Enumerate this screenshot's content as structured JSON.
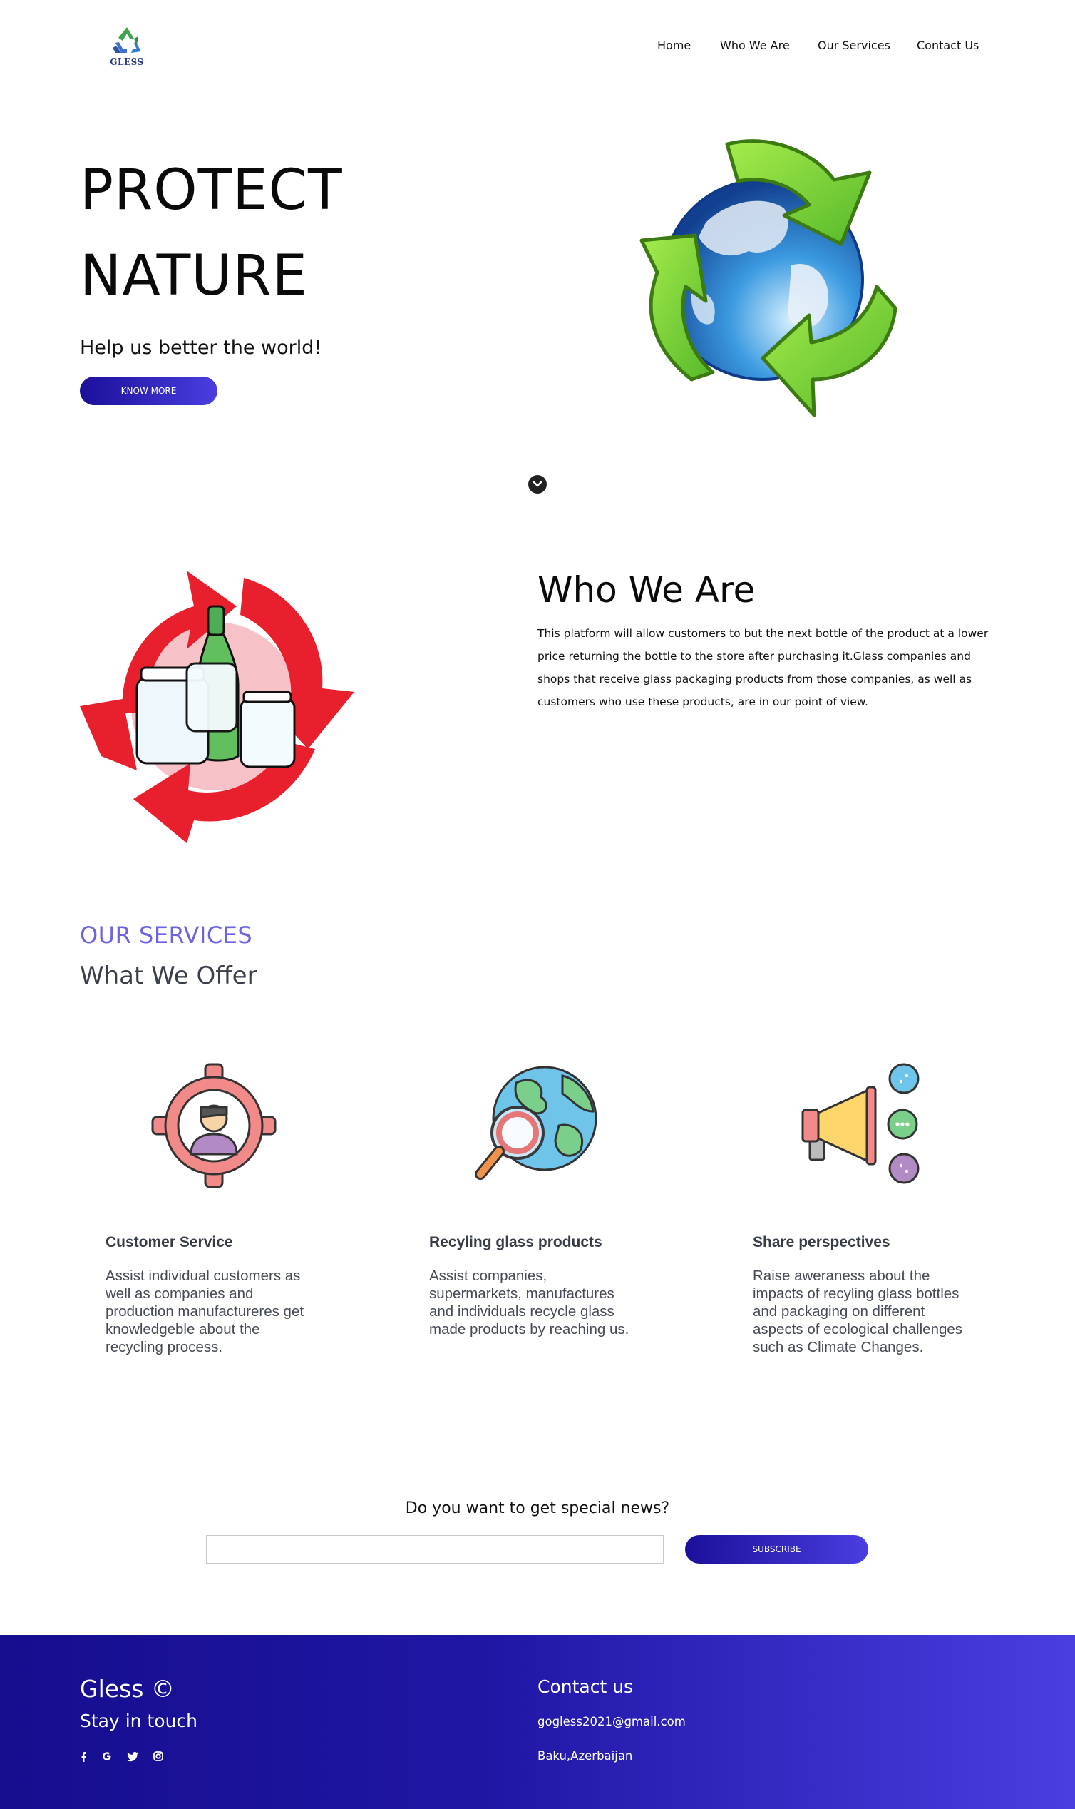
{
  "header": {
    "logo_text": "GLESS",
    "nav": [
      "Home",
      "Who We Are",
      "Our Services",
      "Contact Us"
    ]
  },
  "hero": {
    "title_line1": "PROTECT",
    "title_line2": "NATURE",
    "subtitle": "Help us better the world!",
    "button": "KNOW MORE"
  },
  "who": {
    "title": "Who We Are",
    "text": "This platform will allow customers to but the next bottle of the product at a lower price returning the bottle to the store after purchasing it.Glass companies and shops that receive glass packaging products from those companies, as well as customers who use these products, are in our point of view."
  },
  "services": {
    "kicker": "OUR SERVICES",
    "title": "What We Offer",
    "items": [
      {
        "icon": "customer-target-icon",
        "heading": "Customer Service",
        "body": "Assist individual customers as well as companies and production manufactureres get knowledgeble about the recycling process."
      },
      {
        "icon": "globe-magnifier-icon",
        "heading": "Recyling glass products",
        "body": "Assist companies, supermarkets, manufactures and individuals recycle glass made products by reaching us."
      },
      {
        "icon": "megaphone-icon",
        "heading": "Share perspectives",
        "body": "Raise aweraness about the impacts of recyling glass bottles and packaging on different aspects of ecological challenges such as Climate Changes."
      }
    ]
  },
  "newsletter": {
    "question": "Do you want to get special news?",
    "input_value": "",
    "button": "SUBSCRIBE"
  },
  "footer": {
    "brand": "Gless ©",
    "stay": "Stay in touch",
    "social": [
      "facebook-icon",
      "google-icon",
      "twitter-icon",
      "instagram-icon"
    ],
    "contact_title": "Contact us",
    "email": "gogless2021@gmail.com",
    "address": "Baku,Azerbaijan"
  },
  "colors": {
    "accent_gradient_start": "#1b0f9a",
    "accent_gradient_end": "#4a3ee0",
    "kicker": "#6b63e0",
    "recycle_red": "#e8202e",
    "recycle_green": "#7ad13a"
  }
}
